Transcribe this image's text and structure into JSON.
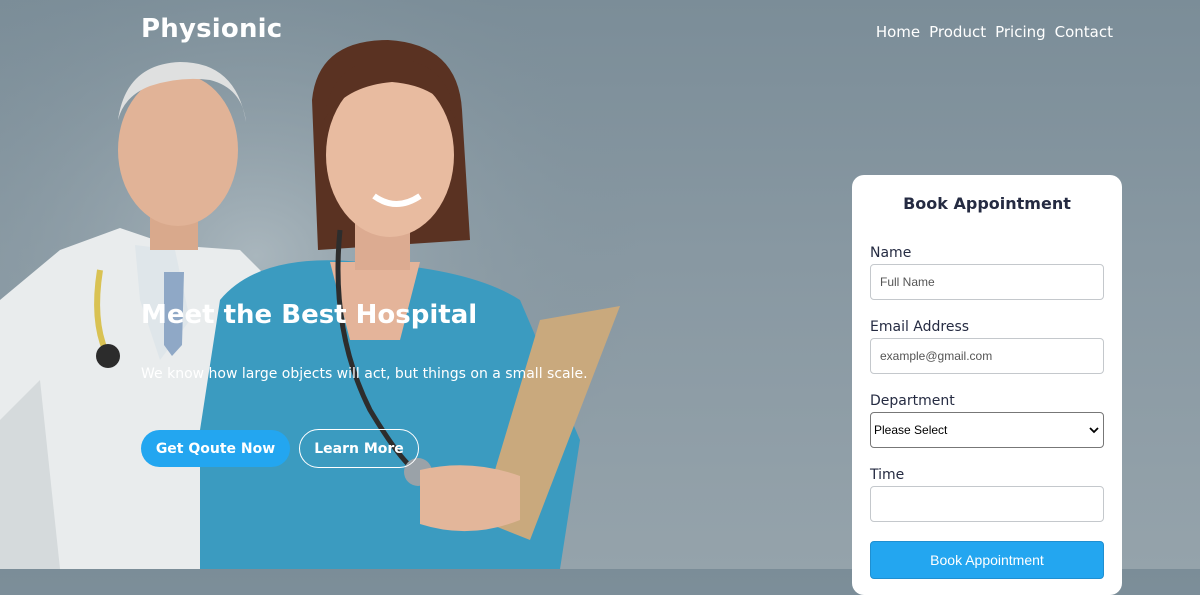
{
  "brand": {
    "logo": "Physionic"
  },
  "nav": {
    "items": [
      "Home",
      "Product",
      "Pricing",
      "Contact"
    ]
  },
  "hero": {
    "title": "Meet the Best Hospital",
    "subtitle": "We know how large objects will act, but things on a small scale.",
    "primary_button": "Get Qoute Now",
    "secondary_button": "Learn More"
  },
  "form": {
    "title": "Book Appointment",
    "name_label": "Name",
    "name_placeholder": "Full Name",
    "email_label": "Email Address",
    "email_placeholder": "example@gmail.com",
    "department_label": "Department",
    "department_selected": "Please Select",
    "time_label": "Time",
    "submit_label": "Book Appointment"
  },
  "colors": {
    "accent": "#23a6f0",
    "heading": "#252b42"
  }
}
